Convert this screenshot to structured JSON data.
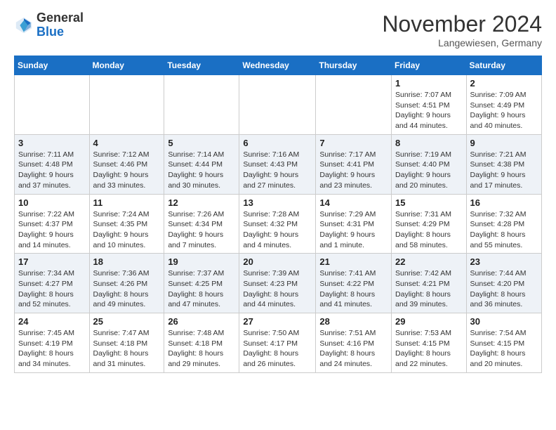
{
  "header": {
    "logo_general": "General",
    "logo_blue": "Blue",
    "month_title": "November 2024",
    "location": "Langewiesen, Germany"
  },
  "weekdays": [
    "Sunday",
    "Monday",
    "Tuesday",
    "Wednesday",
    "Thursday",
    "Friday",
    "Saturday"
  ],
  "weeks": [
    [
      {
        "day": "",
        "info": ""
      },
      {
        "day": "",
        "info": ""
      },
      {
        "day": "",
        "info": ""
      },
      {
        "day": "",
        "info": ""
      },
      {
        "day": "",
        "info": ""
      },
      {
        "day": "1",
        "info": "Sunrise: 7:07 AM\nSunset: 4:51 PM\nDaylight: 9 hours\nand 44 minutes."
      },
      {
        "day": "2",
        "info": "Sunrise: 7:09 AM\nSunset: 4:49 PM\nDaylight: 9 hours\nand 40 minutes."
      }
    ],
    [
      {
        "day": "3",
        "info": "Sunrise: 7:11 AM\nSunset: 4:48 PM\nDaylight: 9 hours\nand 37 minutes."
      },
      {
        "day": "4",
        "info": "Sunrise: 7:12 AM\nSunset: 4:46 PM\nDaylight: 9 hours\nand 33 minutes."
      },
      {
        "day": "5",
        "info": "Sunrise: 7:14 AM\nSunset: 4:44 PM\nDaylight: 9 hours\nand 30 minutes."
      },
      {
        "day": "6",
        "info": "Sunrise: 7:16 AM\nSunset: 4:43 PM\nDaylight: 9 hours\nand 27 minutes."
      },
      {
        "day": "7",
        "info": "Sunrise: 7:17 AM\nSunset: 4:41 PM\nDaylight: 9 hours\nand 23 minutes."
      },
      {
        "day": "8",
        "info": "Sunrise: 7:19 AM\nSunset: 4:40 PM\nDaylight: 9 hours\nand 20 minutes."
      },
      {
        "day": "9",
        "info": "Sunrise: 7:21 AM\nSunset: 4:38 PM\nDaylight: 9 hours\nand 17 minutes."
      }
    ],
    [
      {
        "day": "10",
        "info": "Sunrise: 7:22 AM\nSunset: 4:37 PM\nDaylight: 9 hours\nand 14 minutes."
      },
      {
        "day": "11",
        "info": "Sunrise: 7:24 AM\nSunset: 4:35 PM\nDaylight: 9 hours\nand 10 minutes."
      },
      {
        "day": "12",
        "info": "Sunrise: 7:26 AM\nSunset: 4:34 PM\nDaylight: 9 hours\nand 7 minutes."
      },
      {
        "day": "13",
        "info": "Sunrise: 7:28 AM\nSunset: 4:32 PM\nDaylight: 9 hours\nand 4 minutes."
      },
      {
        "day": "14",
        "info": "Sunrise: 7:29 AM\nSunset: 4:31 PM\nDaylight: 9 hours\nand 1 minute."
      },
      {
        "day": "15",
        "info": "Sunrise: 7:31 AM\nSunset: 4:29 PM\nDaylight: 8 hours\nand 58 minutes."
      },
      {
        "day": "16",
        "info": "Sunrise: 7:32 AM\nSunset: 4:28 PM\nDaylight: 8 hours\nand 55 minutes."
      }
    ],
    [
      {
        "day": "17",
        "info": "Sunrise: 7:34 AM\nSunset: 4:27 PM\nDaylight: 8 hours\nand 52 minutes."
      },
      {
        "day": "18",
        "info": "Sunrise: 7:36 AM\nSunset: 4:26 PM\nDaylight: 8 hours\nand 49 minutes."
      },
      {
        "day": "19",
        "info": "Sunrise: 7:37 AM\nSunset: 4:25 PM\nDaylight: 8 hours\nand 47 minutes."
      },
      {
        "day": "20",
        "info": "Sunrise: 7:39 AM\nSunset: 4:23 PM\nDaylight: 8 hours\nand 44 minutes."
      },
      {
        "day": "21",
        "info": "Sunrise: 7:41 AM\nSunset: 4:22 PM\nDaylight: 8 hours\nand 41 minutes."
      },
      {
        "day": "22",
        "info": "Sunrise: 7:42 AM\nSunset: 4:21 PM\nDaylight: 8 hours\nand 39 minutes."
      },
      {
        "day": "23",
        "info": "Sunrise: 7:44 AM\nSunset: 4:20 PM\nDaylight: 8 hours\nand 36 minutes."
      }
    ],
    [
      {
        "day": "24",
        "info": "Sunrise: 7:45 AM\nSunset: 4:19 PM\nDaylight: 8 hours\nand 34 minutes."
      },
      {
        "day": "25",
        "info": "Sunrise: 7:47 AM\nSunset: 4:18 PM\nDaylight: 8 hours\nand 31 minutes."
      },
      {
        "day": "26",
        "info": "Sunrise: 7:48 AM\nSunset: 4:18 PM\nDaylight: 8 hours\nand 29 minutes."
      },
      {
        "day": "27",
        "info": "Sunrise: 7:50 AM\nSunset: 4:17 PM\nDaylight: 8 hours\nand 26 minutes."
      },
      {
        "day": "28",
        "info": "Sunrise: 7:51 AM\nSunset: 4:16 PM\nDaylight: 8 hours\nand 24 minutes."
      },
      {
        "day": "29",
        "info": "Sunrise: 7:53 AM\nSunset: 4:15 PM\nDaylight: 8 hours\nand 22 minutes."
      },
      {
        "day": "30",
        "info": "Sunrise: 7:54 AM\nSunset: 4:15 PM\nDaylight: 8 hours\nand 20 minutes."
      }
    ]
  ]
}
